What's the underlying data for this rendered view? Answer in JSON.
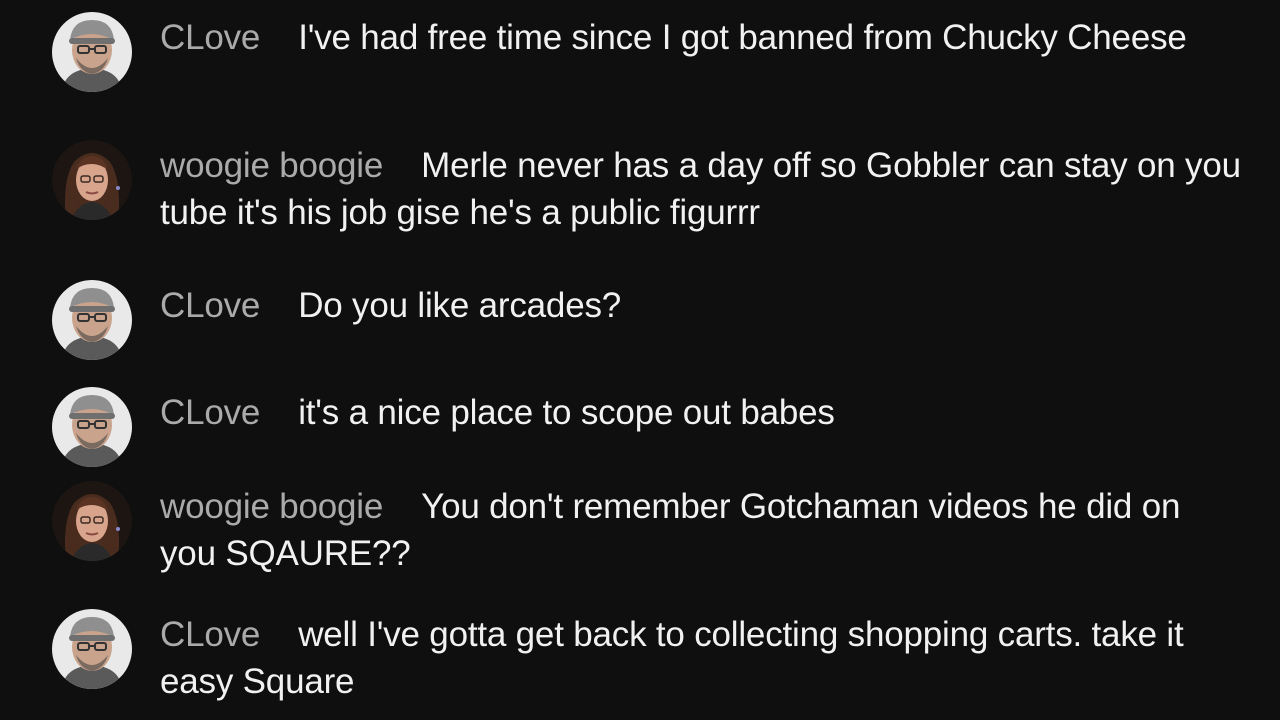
{
  "chat": {
    "messages": [
      {
        "author": "CLove",
        "text": "I've had free time since I got banned from Chucky Cheese"
      },
      {
        "author": "woogie boogie",
        "text": "Merle never has a day off so Gobbler can stay on you tube it's his job gise he's a public figurrr"
      },
      {
        "author": "CLove",
        "text": "Do you like arcades?"
      },
      {
        "author": "CLove",
        "text": "it's a nice place to scope out babes"
      },
      {
        "author": "woogie boogie",
        "text": "You don't remember Gotchaman videos he did on you SQAURE??"
      },
      {
        "author": "CLove",
        "text": "well I've gotta get back to collecting shopping carts. take it easy Square"
      }
    ]
  }
}
